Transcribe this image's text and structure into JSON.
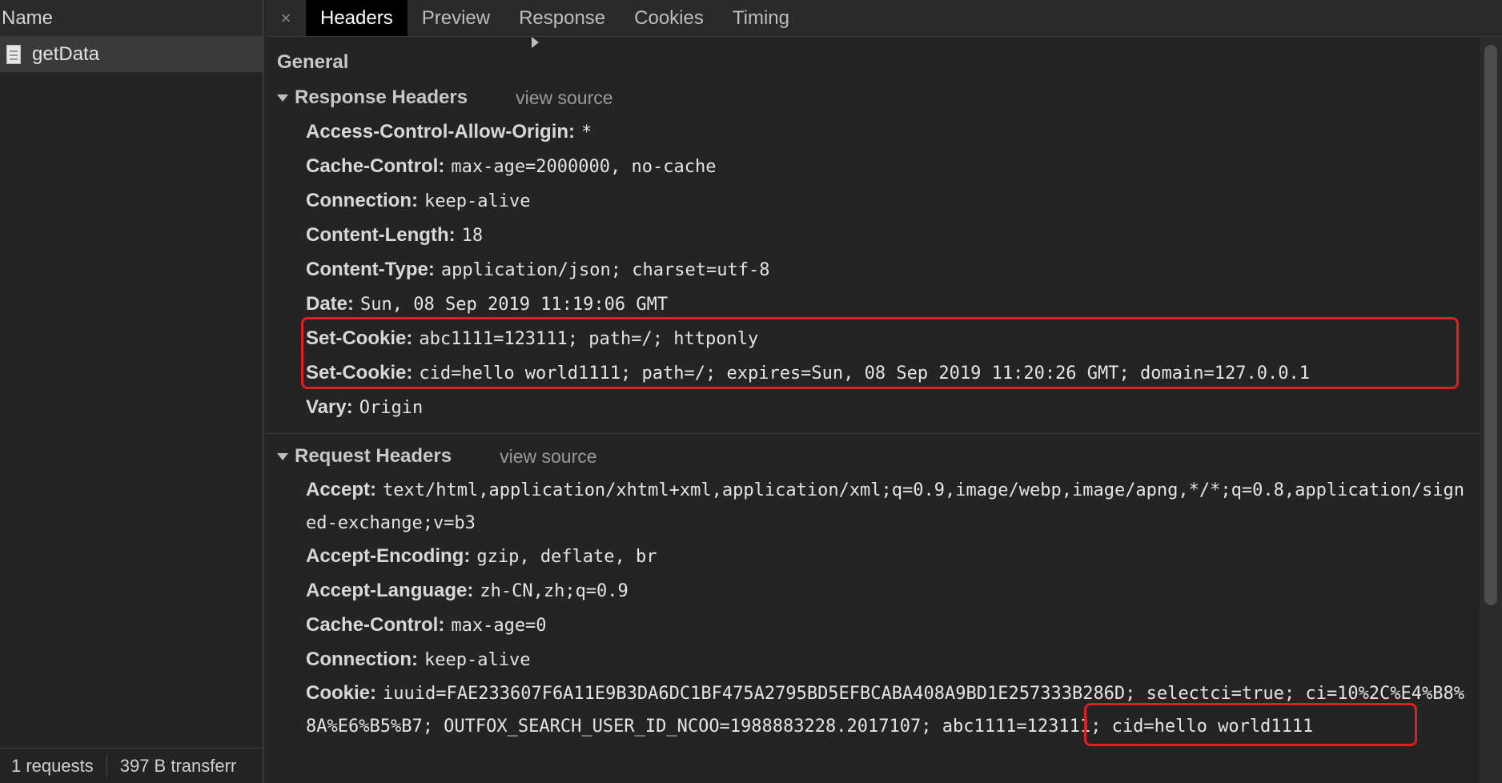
{
  "left_pane": {
    "column_header": "Name",
    "requests": [
      {
        "name": "getData",
        "icon": "document-icon"
      }
    ],
    "footer": {
      "requests": "1 requests",
      "transferred": "397 B transferr"
    }
  },
  "tabs": {
    "close_glyph": "×",
    "items": [
      "Headers",
      "Preview",
      "Response",
      "Cookies",
      "Timing"
    ],
    "active": "Headers"
  },
  "general": {
    "title": "General",
    "expanded": false
  },
  "response_headers": {
    "title": "Response Headers",
    "view_source": "view source",
    "items": [
      {
        "k": "Access-Control-Allow-Origin:",
        "v": "*"
      },
      {
        "k": "Cache-Control:",
        "v": "max-age=2000000, no-cache"
      },
      {
        "k": "Connection:",
        "v": "keep-alive"
      },
      {
        "k": "Content-Length:",
        "v": "18"
      },
      {
        "k": "Content-Type:",
        "v": "application/json; charset=utf-8"
      },
      {
        "k": "Date:",
        "v": "Sun, 08 Sep 2019 11:19:06 GMT"
      },
      {
        "k": "Set-Cookie:",
        "v": "abc1111=123111; path=/; httponly"
      },
      {
        "k": "Set-Cookie:",
        "v": "cid=hello world1111; path=/; expires=Sun, 08 Sep 2019 11:20:26 GMT; domain=127.0.0.1"
      },
      {
        "k": "Vary:",
        "v": "Origin"
      }
    ]
  },
  "request_headers": {
    "title": "Request Headers",
    "view_source": "view source",
    "items": [
      {
        "k": "Accept:",
        "v": "text/html,application/xhtml+xml,application/xml;q=0.9,image/webp,image/apng,*/*;q=0.8,application/signed-exchange;v=b3"
      },
      {
        "k": "Accept-Encoding:",
        "v": "gzip, deflate, br"
      },
      {
        "k": "Accept-Language:",
        "v": "zh-CN,zh;q=0.9"
      },
      {
        "k": "Cache-Control:",
        "v": "max-age=0"
      },
      {
        "k": "Connection:",
        "v": "keep-alive"
      },
      {
        "k": "Cookie:",
        "v": "iuuid=FAE233607F6A11E9B3DA6DC1BF475A2795BD5EFBCABA408A9BD1E257333B286D; selectci=true; ci=10%2C%E4%B8%8A%E6%B5%B7; OUTFOX_SEARCH_USER_ID_NCOO=1988883228.2017107; abc1111=123111; cid=hello world1111"
      }
    ]
  },
  "colors": {
    "highlight": "#e02020",
    "active_tab_bg": "#000000",
    "background": "#242424"
  }
}
